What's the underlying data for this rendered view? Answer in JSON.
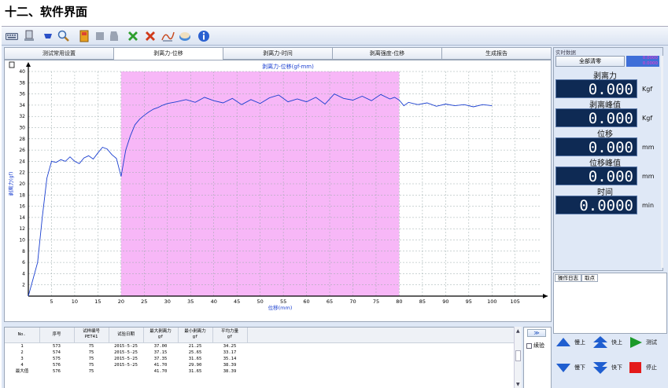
{
  "doc_heading": "十二、软件界面",
  "tabs": [
    {
      "label": "测试常用设置",
      "active": false
    },
    {
      "label": "剥离力-位移",
      "active": true
    },
    {
      "label": "剥离力-时间",
      "active": false
    },
    {
      "label": "剥离强度-位移",
      "active": false
    },
    {
      "label": "生成报告",
      "active": false
    }
  ],
  "chart": {
    "title": "剥离力-位移(gf-mm)",
    "xlabel": "位移(mm)",
    "ylabel": "剥离力(gf)",
    "highlight_range": [
      20,
      80
    ]
  },
  "chart_data": {
    "type": "line",
    "title": "剥离力-位移(gf-mm)",
    "xlabel": "位移(mm)",
    "ylabel": "剥离力(gf)",
    "xlim": [
      0,
      112
    ],
    "ylim": [
      0,
      40
    ],
    "xticks": [
      5,
      10,
      15,
      20,
      25,
      30,
      35,
      40,
      45,
      50,
      55,
      60,
      65,
      70,
      75,
      80,
      85,
      90,
      95,
      100,
      105
    ],
    "yticks": [
      2,
      4,
      6,
      8,
      10,
      12,
      14,
      16,
      18,
      20,
      22,
      24,
      26,
      28,
      30,
      32,
      34,
      36,
      38,
      40
    ],
    "grid": true,
    "series": [
      {
        "color": "#1a3fd0",
        "x": [
          0,
          1,
          2,
          3,
          4,
          5,
          6,
          7,
          8,
          9,
          10,
          11,
          12,
          13,
          14,
          15,
          16,
          17,
          18,
          19,
          20,
          21,
          22,
          23,
          24,
          25,
          26,
          27,
          28,
          29,
          30,
          32,
          34,
          36,
          38,
          40,
          42,
          44,
          46,
          48,
          50,
          52,
          54,
          56,
          58,
          60,
          62,
          64,
          66,
          68,
          70,
          72,
          74,
          76,
          78,
          79,
          80,
          81,
          82,
          84,
          86,
          88,
          90,
          92,
          94,
          96,
          98,
          100
        ],
        "y": [
          0,
          3,
          6,
          14,
          21,
          24,
          23.8,
          24.3,
          24,
          24.8,
          24,
          23.6,
          24.6,
          25,
          24.4,
          25.5,
          26.5,
          26.2,
          25.2,
          24.5,
          21.3,
          26,
          28.5,
          30.5,
          31.5,
          32.2,
          32.8,
          33.3,
          33.6,
          34,
          34.3,
          34.6,
          35,
          34.5,
          35.4,
          34.8,
          34.4,
          35.2,
          34.1,
          35,
          34.3,
          35.3,
          35.8,
          34.6,
          35.1,
          34.6,
          35.4,
          34.2,
          36,
          35.2,
          34.9,
          35.6,
          34.8,
          35.9,
          35.1,
          35.4,
          34.9,
          33.9,
          34.5,
          34.1,
          34.4,
          33.8,
          34.2,
          33.9,
          34.1,
          33.7,
          34.1,
          33.9
        ]
      }
    ]
  },
  "table": {
    "headers": [
      "No.",
      "序号",
      "试样编号\nPET41",
      "试验日期",
      "最大剥离力\ngf",
      "最小剥离力\ngf",
      "平均力量\ngf"
    ],
    "rows": [
      [
        "1",
        "573",
        "75",
        "2015-5-25",
        "37.00",
        "21.25",
        "34.25"
      ],
      [
        "2",
        "574",
        "75",
        "2015-5-25",
        "37.15",
        "25.65",
        "33.17"
      ],
      [
        "3",
        "575",
        "75",
        "2015-5-25",
        "37.35",
        "31.65",
        "35.14"
      ],
      [
        "4",
        "576",
        "75",
        "2015-5-25",
        "41.70",
        "29.90",
        "38.39"
      ],
      [
        "最大值",
        "576",
        "75",
        "",
        "41.70",
        "31.65",
        "38.39"
      ]
    ]
  },
  "continue_label": "续验",
  "right_panel": {
    "header": "实时数据",
    "clear_all": "全部清零",
    "mini_value_top": "0.0000",
    "mini_value_bottom": "0.0000",
    "readouts": [
      {
        "label": "剥离力",
        "value": "0.000",
        "unit": "Kgf"
      },
      {
        "label": "剥离峰值",
        "value": "0.000",
        "unit": "Kgf"
      },
      {
        "label": "位移",
        "value": "0.000",
        "unit": "mm"
      },
      {
        "label": "位移峰值",
        "value": "0.000",
        "unit": "mm"
      },
      {
        "label": "时间",
        "value": "0.0000",
        "unit": "min"
      }
    ]
  },
  "log_tabs": [
    "操作日志",
    "取点"
  ],
  "controls": {
    "slow_up": "慢上",
    "fast_up": "快上",
    "test": "测试",
    "slow_down": "慢下",
    "fast_down": "快下",
    "stop": "停止"
  },
  "colors": {
    "highlight": "#f7b7f7",
    "curve": "#1a3fd0",
    "readout_bg": "#0e2a54",
    "app_bg": "#dfe8f6"
  }
}
